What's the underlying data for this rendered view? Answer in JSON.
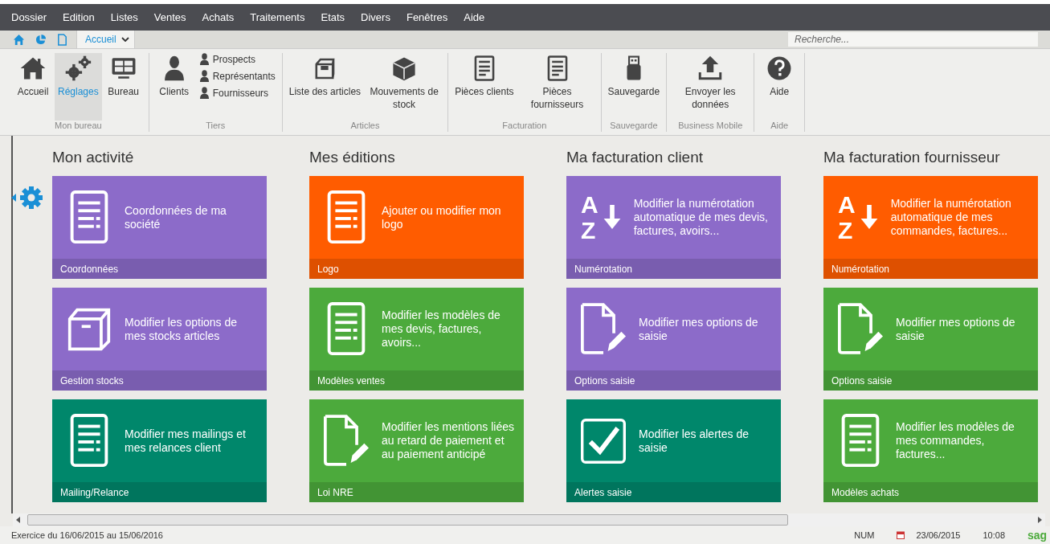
{
  "menu": [
    "Dossier",
    "Edition",
    "Listes",
    "Ventes",
    "Achats",
    "Traitements",
    "Etats",
    "Divers",
    "Fenêtres",
    "Aide"
  ],
  "tab": {
    "label": "Accueil"
  },
  "search": {
    "placeholder": "Recherche..."
  },
  "ribbon": [
    {
      "label": "Mon bureau",
      "items": [
        {
          "kind": "home",
          "label": "Accueil",
          "selected": false
        },
        {
          "kind": "gears",
          "label": "Réglages",
          "selected": true
        },
        {
          "kind": "monitor",
          "label": "Bureau",
          "selected": false
        }
      ]
    },
    {
      "label": "Tiers",
      "items": [
        {
          "kind": "person",
          "label": "Clients",
          "selected": false
        },
        {
          "kind": "contact",
          "label": "Prospects",
          "selected": false
        },
        {
          "kind": "contact",
          "label": "Représentants",
          "selected": false
        },
        {
          "kind": "contact",
          "label": "Fournisseurs",
          "selected": false
        }
      ]
    },
    {
      "label": "Articles",
      "items": [
        {
          "kind": "box",
          "label": "Liste des articles",
          "selected": false
        },
        {
          "kind": "crate",
          "label": "Mouvements de stock",
          "selected": false
        }
      ]
    },
    {
      "label": "Facturation",
      "items": [
        {
          "kind": "form",
          "label": "Pièces clients",
          "selected": false
        },
        {
          "kind": "form",
          "label": "Pièces fournisseurs",
          "selected": false
        }
      ]
    },
    {
      "label": "Sauvegarde",
      "items": [
        {
          "kind": "usb",
          "label": "Sauvegarde",
          "selected": false
        }
      ]
    },
    {
      "label": "Business Mobile",
      "items": [
        {
          "kind": "upload",
          "label": "Envoyer les données",
          "selected": false
        }
      ]
    },
    {
      "label": "Aide",
      "items": [
        {
          "kind": "help",
          "label": "Aide",
          "selected": false
        }
      ]
    }
  ],
  "sections": [
    {
      "title": "Mon activité",
      "tiles": [
        {
          "color": "#8c6bc9",
          "kind": "doc",
          "text": "Coordonnées de ma société",
          "label": "Coordonnées"
        },
        {
          "color": "#8c6bc9",
          "kind": "box",
          "text": "Modifier les options de mes stocks articles",
          "label": "Gestion stocks"
        },
        {
          "color": "#00876b",
          "kind": "doc",
          "text": "Modifier mes mailings et mes relances client",
          "label": "Mailing/Relance"
        }
      ]
    },
    {
      "title": "Mes éditions",
      "tiles": [
        {
          "color": "#ff5c00",
          "kind": "doc",
          "text": "Ajouter ou modifier mon logo",
          "label": "Logo"
        },
        {
          "color": "#4caa3c",
          "kind": "doc",
          "text": "Modifier les modèles de mes devis, factures, avoirs...",
          "label": "Modèles ventes"
        },
        {
          "color": "#4caa3c",
          "kind": "pen",
          "text": "Modifier les mentions liées au retard de paiement et au paiement anticipé",
          "label": "Loi NRE"
        }
      ]
    },
    {
      "title": "Ma facturation client",
      "tiles": [
        {
          "color": "#8c6bc9",
          "kind": "sort",
          "letters": [
            "A",
            "Z"
          ],
          "text": "Modifier la numérotation automatique de mes devis, factures, avoirs...",
          "label": "Numérotation"
        },
        {
          "color": "#8c6bc9",
          "kind": "pen",
          "text": "Modifier mes options de saisie",
          "label": "Options saisie"
        },
        {
          "color": "#00876b",
          "kind": "check",
          "text": "Modifier les alertes de saisie",
          "label": "Alertes saisie"
        }
      ]
    },
    {
      "title": "Ma facturation fournisseur",
      "tiles": [
        {
          "color": "#ff5c00",
          "kind": "sort",
          "letters": [
            "A",
            "Z"
          ],
          "text": "Modifier la numérotation automatique de mes commandes, factures...",
          "label": "Numérotation"
        },
        {
          "color": "#4caa3c",
          "kind": "pen",
          "text": "Modifier mes options de saisie",
          "label": "Options saisie"
        },
        {
          "color": "#4caa3c",
          "kind": "doc",
          "text": "Modifier les modèles de mes commandes, factures...",
          "label": "Modèles achats"
        }
      ]
    }
  ],
  "status": {
    "left": "Exercice du 16/06/2015 au 15/06/2016",
    "mode": "NUM",
    "date": "23/06/2015",
    "time": "10:08",
    "brand": "sag"
  }
}
